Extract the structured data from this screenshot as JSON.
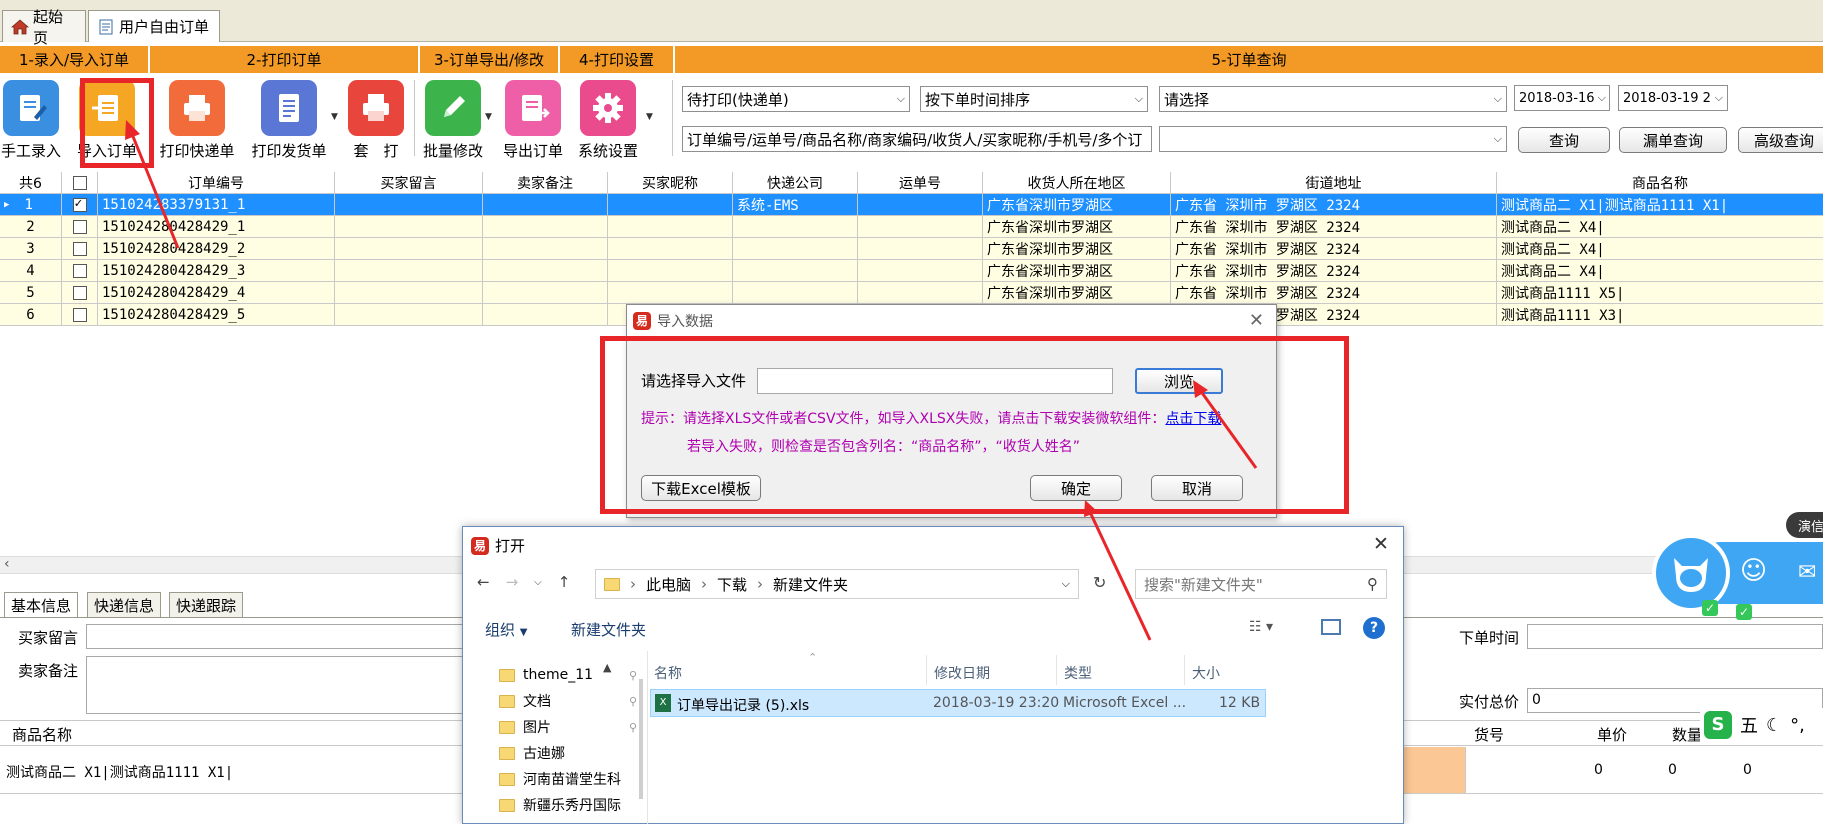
{
  "tabs": [
    {
      "label": "起始页",
      "icon": "home-icon"
    },
    {
      "label": "用户自由订单",
      "icon": "document-icon"
    }
  ],
  "sections": [
    "1-录入/导入订单",
    "2-打印订单",
    "3-订单导出/修改",
    "4-打印设置",
    "5-订单查询"
  ],
  "toolbar": {
    "manual_entry": "手工录入",
    "import_order": "导入订单",
    "print_express": "打印快递单",
    "print_invoice": "打印发货单",
    "print_set": "套　打",
    "batch_edit": "批量修改",
    "export_order": "导出订单",
    "system_settings": "系统设置"
  },
  "filters": {
    "status": "待打印(快递单)",
    "sort": "按下单时间排序",
    "select": "请选择",
    "date_from": "2018-03-16",
    "date_to": "2018-03-19 2",
    "search_placeholder": "订单编号/运单号/商品名称/商家编码/收货人/买家昵称/手机号/多个订",
    "query": "查询",
    "missing_query": "漏单查询",
    "advanced_query": "高级查询"
  },
  "grid": {
    "count_label": "共6",
    "columns": [
      "订单编号",
      "买家留言",
      "卖家备注",
      "买家昵称",
      "快递公司",
      "运单号",
      "收货人所在地区",
      "街道地址",
      "商品名称"
    ],
    "rows": [
      {
        "n": "1",
        "checked": true,
        "order": "151024283379131_1",
        "express": "系统-EMS",
        "region": "广东省深圳市罗湖区",
        "street": "广东省 深圳市 罗湖区 2324",
        "product": "测试商品二 X1|测试商品1111 X1|"
      },
      {
        "n": "2",
        "checked": false,
        "order": "151024280428429_1",
        "express": "",
        "region": "广东省深圳市罗湖区",
        "street": "广东省 深圳市 罗湖区 2324",
        "product": "测试商品二 X4|"
      },
      {
        "n": "3",
        "checked": false,
        "order": "151024280428429_2",
        "express": "",
        "region": "广东省深圳市罗湖区",
        "street": "广东省 深圳市 罗湖区 2324",
        "product": "测试商品二 X4|"
      },
      {
        "n": "4",
        "checked": false,
        "order": "151024280428429_3",
        "express": "",
        "region": "广东省深圳市罗湖区",
        "street": "广东省 深圳市 罗湖区 2324",
        "product": "测试商品二 X4|"
      },
      {
        "n": "5",
        "checked": false,
        "order": "151024280428429_4",
        "express": "",
        "region": "广东省深圳市罗湖区",
        "street": "广东省 深圳市 罗湖区 2324",
        "product": "测试商品1111 X5|"
      },
      {
        "n": "6",
        "checked": false,
        "order": "151024280428429_5",
        "express": "",
        "region": "",
        "street": "广东省 深圳市 罗湖区 2324",
        "product": "测试商品1111 X3|"
      }
    ]
  },
  "bottom": {
    "tabs": [
      "基本信息",
      "快递信息",
      "快递跟踪"
    ],
    "buyer_msg": "买家留言",
    "seller_note": "卖家备注",
    "product_name_hdr": "商品名称",
    "product_value": "测试商品二 X1|测试商品1111 X1|",
    "order_time": "下单时间",
    "paid_total": "实付总价",
    "paid_value": "0",
    "cols": [
      "货号",
      "单价",
      "数量"
    ],
    "vals": [
      "0",
      "0",
      "0"
    ]
  },
  "import_dialog": {
    "title": "导入数据",
    "file_label": "请选择导入文件",
    "browse": "浏览",
    "hint1_prefix": "提示：请选择XLS文件或者CSV文件，如导入XLSX失败，请点击下载安装微软组件：",
    "hint1_link": "点击下载",
    "hint2": "若导入失败，则检查是否包含列名：“商品名称”，“收货人姓名”",
    "download_template": "下载Excel模板",
    "ok": "确定",
    "cancel": "取消"
  },
  "open_dialog": {
    "title": "打开",
    "path": [
      "此电脑",
      "下载",
      "新建文件夹"
    ],
    "search_placeholder": "搜索\"新建文件夹\"",
    "organize": "组织",
    "new_folder": "新建文件夹",
    "sidebar": [
      "theme_11",
      "文档",
      "图片",
      "古迪娜",
      "河南苗谱堂生科",
      "新疆乐秀丹国际"
    ],
    "columns": [
      "名称",
      "修改日期",
      "类型",
      "大小"
    ],
    "file": {
      "name": "订单导出记录 (5).xls",
      "date": "2018-03-19 23:20",
      "type": "Microsoft Excel ...",
      "size": "12 KB"
    }
  },
  "floating": {
    "badge": "演信",
    "ime": "五"
  },
  "colors": {
    "accent_orange": "#f39a26",
    "highlight_red": "#e8262a",
    "select_blue": "#1e90ff"
  }
}
